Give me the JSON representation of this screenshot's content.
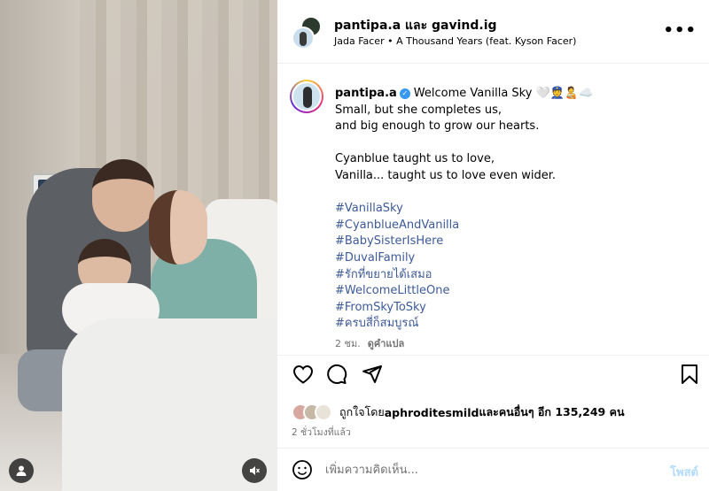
{
  "header": {
    "title": "pantipa.a และ gavind.ig",
    "subtitle": "Jada Facer • A Thousand Years (feat. Kyson Facer)",
    "more_icon": "more-horizontal-icon"
  },
  "caption": {
    "username": "pantipa.a",
    "verified": true,
    "first_line": "Welcome Vanilla Sky 🤍👮🧑‍🍼☁️",
    "lines_block1": [
      "Small, but she completes us,",
      "and big enough to grow our hearts."
    ],
    "lines_block2": [
      "Cyanblue taught us to love,",
      "Vanilla... taught us to love even wider."
    ],
    "hashtags": [
      "#VanillaSky",
      "#CyanblueAndVanilla",
      "#BabySisterIsHere",
      "#DuvalFamily",
      "#รักที่ขยายได้เสมอ",
      "#WelcomeLittleOne",
      "#FromSkyToSky",
      "#ครบสี่ก็สมบูรณ์"
    ],
    "time": "2 ชม.",
    "see_translation": "ดูคำแปล"
  },
  "actions": {
    "like_icon": "heart-icon",
    "comment_icon": "comment-icon",
    "share_icon": "send-icon",
    "save_icon": "bookmark-icon"
  },
  "likes": {
    "text_prefix": "ถูกใจโดย ",
    "user": "aphroditesmild",
    "text_suffix": " และคนอื่นๆ อีก 135,249 คน"
  },
  "posted_ago": "2 ชั่วโมงที่แล้ว",
  "comment": {
    "placeholder": "เพิ่มความคิดเห็น...",
    "post_label": "โพสต์"
  },
  "media": {
    "user_icon": "user-tag-icon",
    "mute_icon": "muted-speaker-icon"
  },
  "colors": {
    "hashtag": "#3d5a99",
    "verified": "#3897f0",
    "post_disabled": "#b3dbff"
  }
}
